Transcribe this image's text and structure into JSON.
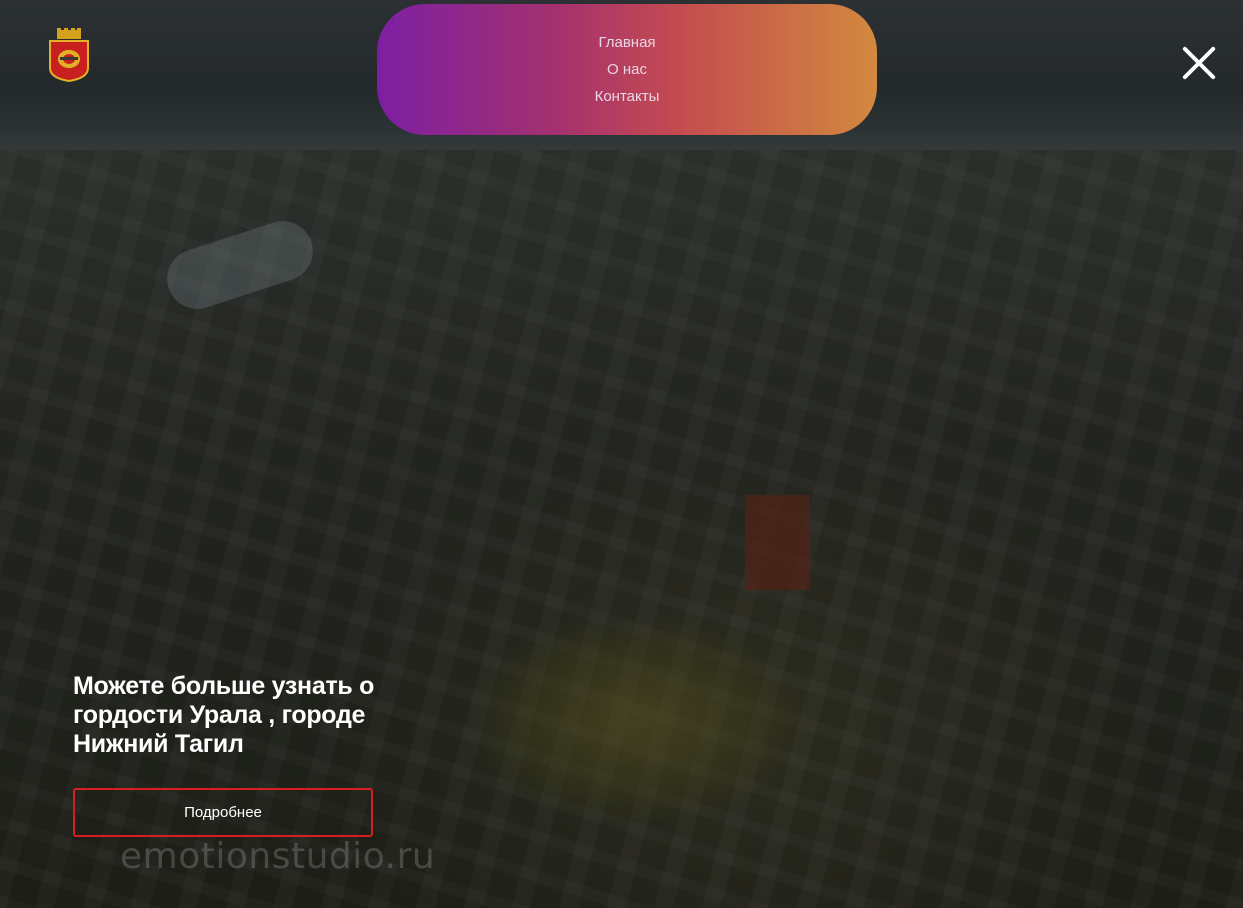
{
  "nav": {
    "items": [
      {
        "label": "Главная"
      },
      {
        "label": "О нас"
      },
      {
        "label": "Контакты"
      }
    ],
    "gradient": [
      "#7d1fa3",
      "#c44b50",
      "#d2893e"
    ]
  },
  "header": {
    "logo_icon": "city-coat-of-arms-icon",
    "close_icon": "close-icon"
  },
  "hero": {
    "title": "Можете больше узнать о гордости Урала , городе Нижний Тагил",
    "button_label": "Подробнее",
    "button_border_color": "#d81f1f"
  },
  "background": {
    "watermark": "emotionstudio.ru"
  }
}
